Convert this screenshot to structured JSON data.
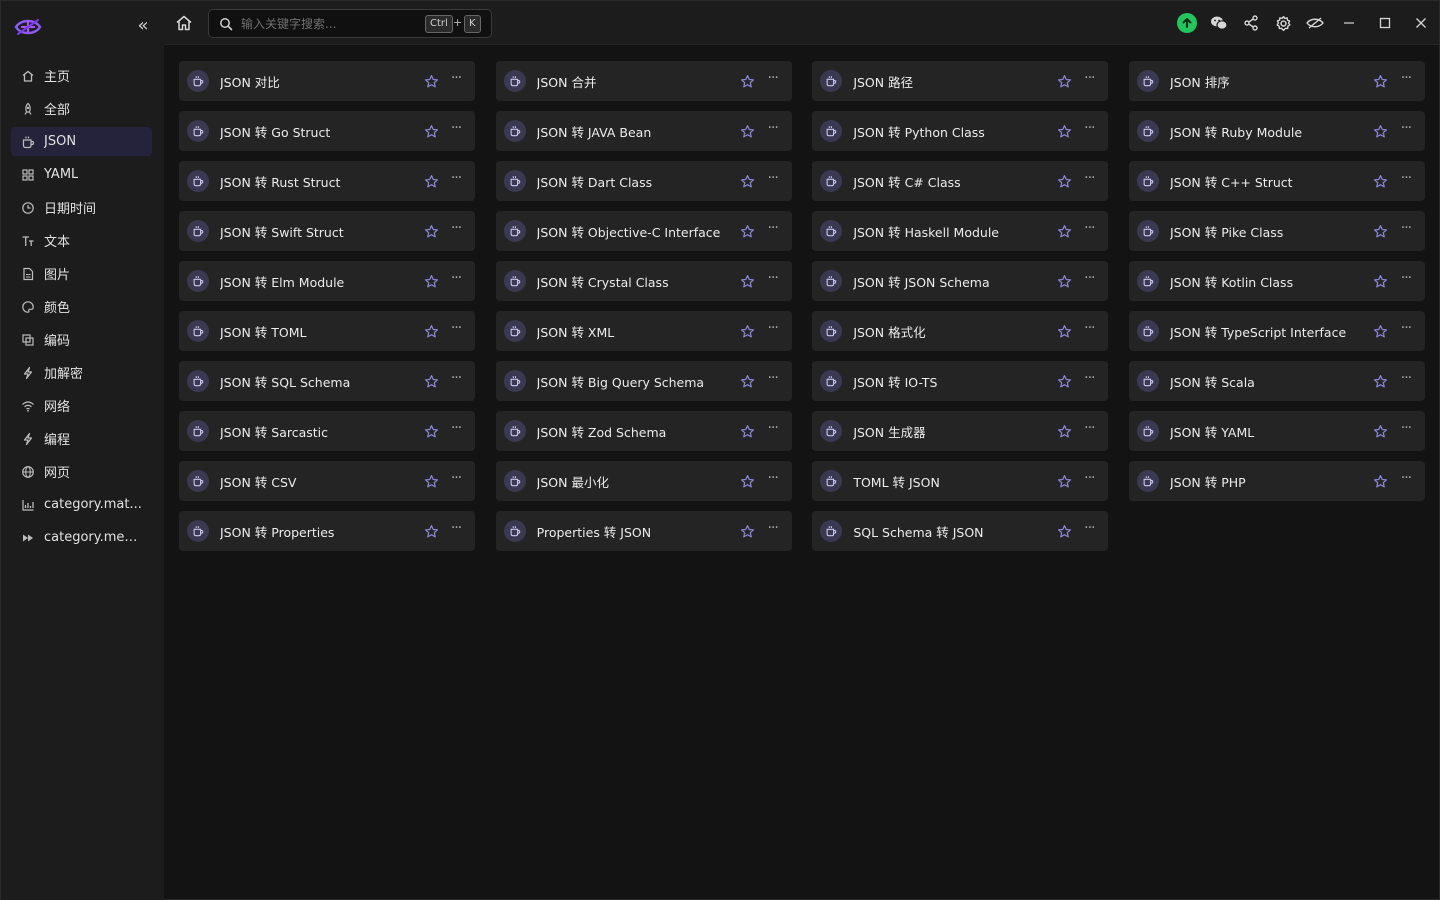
{
  "sidebar": {
    "collapse_glyph": "«",
    "items": [
      {
        "label": "主页",
        "icon": "home-icon",
        "active": false
      },
      {
        "label": "全部",
        "icon": "rocket-icon",
        "active": false
      },
      {
        "label": "JSON",
        "icon": "cup-icon",
        "active": true
      },
      {
        "label": "YAML",
        "icon": "grid-icon",
        "active": false
      },
      {
        "label": "日期时间",
        "icon": "clock-icon",
        "active": false
      },
      {
        "label": "文本",
        "icon": "text-icon",
        "active": false
      },
      {
        "label": "图片",
        "icon": "image-icon",
        "active": false
      },
      {
        "label": "颜色",
        "icon": "palette-icon",
        "active": false
      },
      {
        "label": "编码",
        "icon": "code-icon",
        "active": false
      },
      {
        "label": "加解密",
        "icon": "bolt-icon",
        "active": false
      },
      {
        "label": "网络",
        "icon": "wifi-icon",
        "active": false
      },
      {
        "label": "编程",
        "icon": "bolt-icon",
        "active": false
      },
      {
        "label": "网页",
        "icon": "globe-icon",
        "active": false
      },
      {
        "label": "category.mat...",
        "icon": "chart-icon",
        "active": false
      },
      {
        "label": "category.med...",
        "icon": "media-icon",
        "active": false
      }
    ]
  },
  "search": {
    "placeholder": "输入关键字搜索...",
    "value": "",
    "shortcut_key1": "Ctrl",
    "shortcut_plus": "+",
    "shortcut_key2": "K"
  },
  "colors": {
    "accent": "#8b86d8",
    "update": "#22c55e",
    "active_nav": "#24233b",
    "card_bg": "#242424"
  },
  "tools": [
    "JSON 对比",
    "JSON 合并",
    "JSON 路径",
    "JSON 排序",
    "JSON 转 Go Struct",
    "JSON 转 JAVA Bean",
    "JSON 转 Python Class",
    "JSON 转 Ruby Module",
    "JSON 转 Rust Struct",
    "JSON 转 Dart Class",
    "JSON 转 C# Class",
    "JSON 转 C++ Struct",
    "JSON 转 Swift Struct",
    "JSON 转 Objective-C Interface",
    "JSON 转 Haskell Module",
    "JSON 转 Pike Class",
    "JSON 转 Elm Module",
    "JSON 转 Crystal Class",
    "JSON 转 JSON Schema",
    "JSON 转 Kotlin Class",
    "JSON 转 TOML",
    "JSON 转 XML",
    "JSON 格式化",
    "JSON 转 TypeScript Interface",
    "JSON 转 SQL Schema",
    "JSON 转 Big Query Schema",
    "JSON 转 IO-TS",
    "JSON 转 Scala",
    "JSON 转 Sarcastic",
    "JSON 转 Zod Schema",
    "JSON 生成器",
    "JSON 转 YAML",
    "JSON 转 CSV",
    "JSON 最小化",
    "TOML 转 JSON",
    "JSON 转 PHP",
    "JSON 转 Properties",
    "Properties 转 JSON",
    "SQL Schema 转 JSON"
  ]
}
